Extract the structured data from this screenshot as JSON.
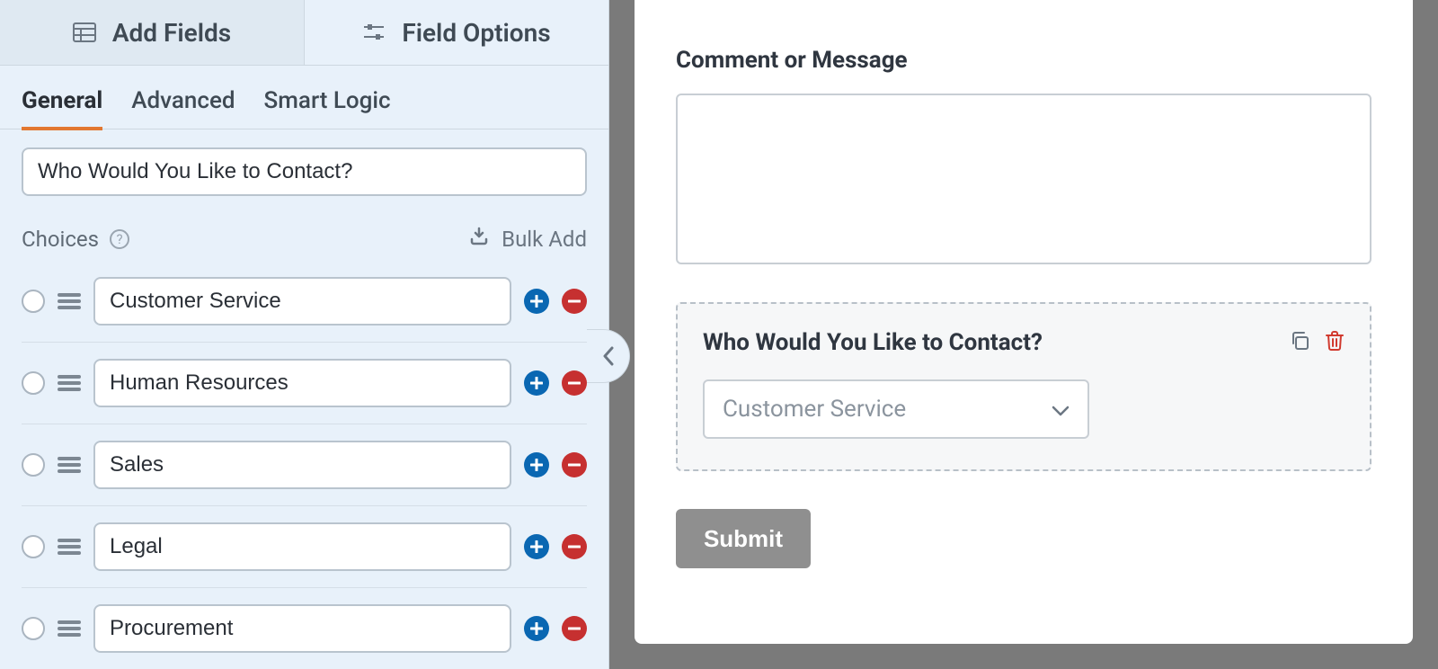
{
  "top_tabs": {
    "add_fields": "Add Fields",
    "field_options": "Field Options"
  },
  "sub_tabs": {
    "general": "General",
    "advanced": "Advanced",
    "smart_logic": "Smart Logic"
  },
  "field_label_value": "Who Would You Like to Contact?",
  "choices_label": "Choices",
  "bulk_add_label": "Bulk Add",
  "choices": [
    {
      "value": "Customer Service"
    },
    {
      "value": "Human Resources"
    },
    {
      "value": "Sales"
    },
    {
      "value": "Legal"
    },
    {
      "value": "Procurement"
    }
  ],
  "preview": {
    "comment_label": "Comment or Message",
    "contact_label": "Who Would You Like to Contact?",
    "dropdown_selected": "Customer Service",
    "submit_label": "Submit"
  }
}
